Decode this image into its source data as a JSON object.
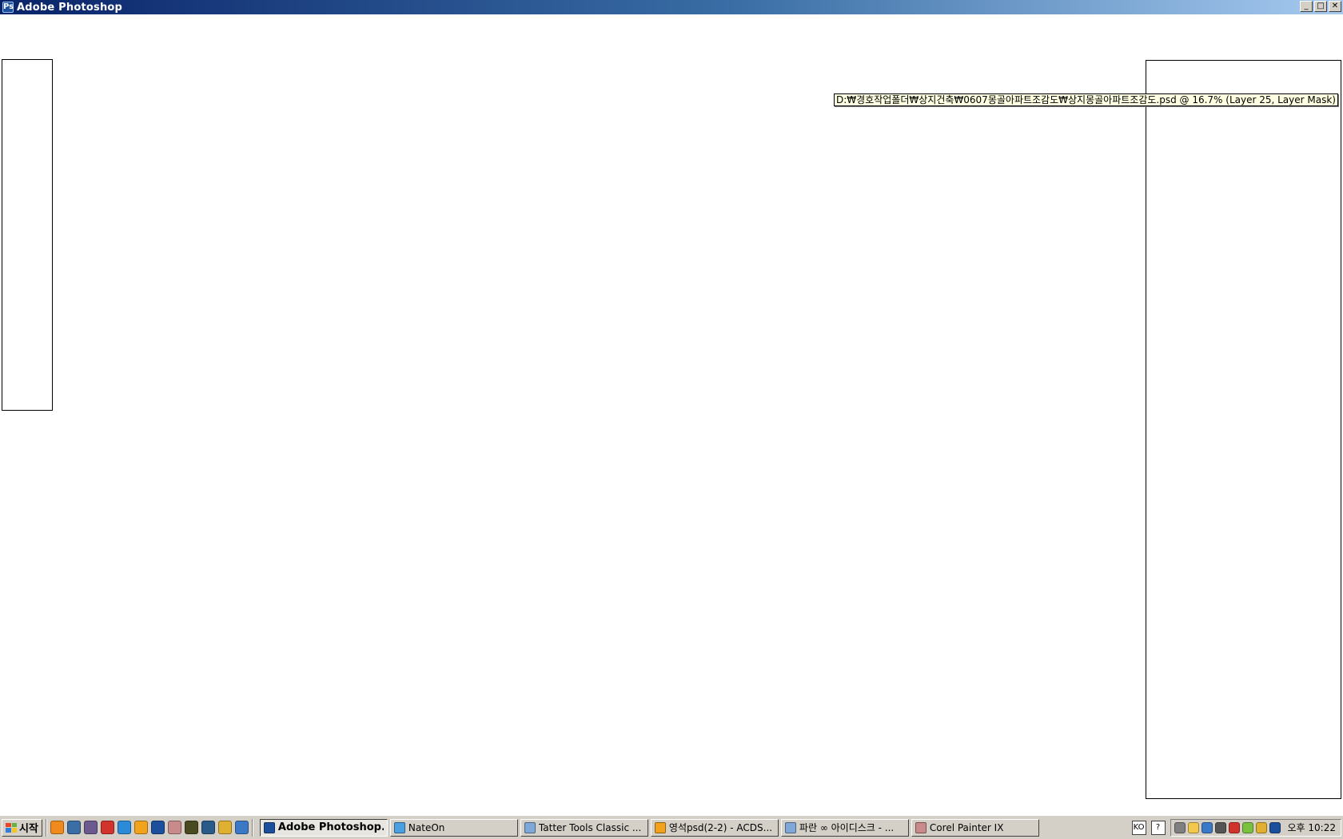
{
  "window": {
    "title": "Adobe Photoshop",
    "app_icon": "photoshop-icon",
    "controls": {
      "minimize": "_",
      "maximize": "□",
      "close": "✕"
    }
  },
  "document": {
    "path_tooltip": "D:₩경호작업폴더₩상지건축₩0607몽골아파트조감도₩상지몽골아파트조감도.psd @ 16.7% (Layer 25, Layer Mask)"
  },
  "taskbar": {
    "start_label": "시작",
    "quick_launch": [
      {
        "icon": "firefox-icon",
        "color": "#f08a1c"
      },
      {
        "icon": "desktop-icon",
        "color": "#3a6ea5"
      },
      {
        "icon": "app-icon",
        "color": "#6b5a8e"
      },
      {
        "icon": "media-icon",
        "color": "#d0342c"
      },
      {
        "icon": "browser-icon",
        "color": "#2b8bd8"
      },
      {
        "icon": "acdsee-icon",
        "color": "#f2a31e"
      },
      {
        "icon": "photoshop-icon",
        "color": "#1c4f9c"
      },
      {
        "icon": "painter-icon",
        "color": "#c88a8a"
      },
      {
        "icon": "illustrator-icon",
        "color": "#4a4a20"
      },
      {
        "icon": "tool-icon",
        "color": "#2a5a8a"
      },
      {
        "icon": "pencil-icon",
        "color": "#e0b030"
      },
      {
        "icon": "ie-icon",
        "color": "#3b79c6"
      }
    ],
    "tasks": [
      {
        "label": "Adobe Photoshop...",
        "icon": "photoshop-icon",
        "color": "#1c4f9c",
        "active": true
      },
      {
        "label": "NateOn",
        "icon": "nateon-icon",
        "color": "#4aa0e0",
        "active": false
      },
      {
        "label": "Tatter Tools Classic ...",
        "icon": "ie-page-icon",
        "color": "#7fa8d8",
        "active": false
      },
      {
        "label": "영석psd(2-2) - ACDS...",
        "icon": "acdsee-icon",
        "color": "#f2a31e",
        "active": false
      },
      {
        "label": "파란 ∞ 아이디스크 - ...",
        "icon": "ie-page-icon",
        "color": "#7fa8d8",
        "active": false
      },
      {
        "label": "Corel Painter IX",
        "icon": "painter-icon",
        "color": "#c88a8a",
        "active": false
      }
    ],
    "ime_mode": "KO",
    "ime_help": "?",
    "tray_icons": [
      {
        "icon": "keyboard-icon",
        "color": "#808080"
      },
      {
        "icon": "nateon-tray-icon",
        "color": "#f2c94c"
      },
      {
        "icon": "network-icon",
        "color": "#3b79c6"
      },
      {
        "icon": "volume-icon",
        "color": "#555555"
      },
      {
        "icon": "flash-icon",
        "color": "#d0342c"
      },
      {
        "icon": "monitor-icon",
        "color": "#7ac142"
      },
      {
        "icon": "pencil-icon",
        "color": "#e0b030"
      },
      {
        "icon": "antivirus-icon",
        "color": "#1c4f9c"
      }
    ],
    "clock": "오후 10:22"
  }
}
